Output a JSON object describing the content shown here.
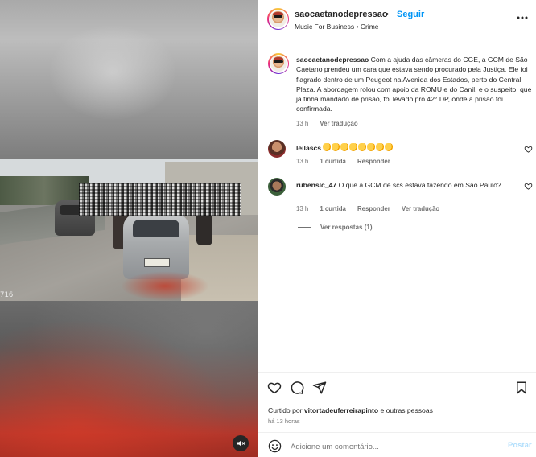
{
  "post": {
    "username": "saocaetanodepressao",
    "dot": "•",
    "follow_label": "Seguir",
    "subtitle": "Music For Business • Crime",
    "video_timestamp": "716"
  },
  "comments": [
    {
      "username": "saocaetanodepressao",
      "text": "Com a ajuda das câmeras do CGE, a GCM de São Caetano prendeu um cara que estava sendo procurado pela Justiça. Ele foi flagrado dentro de um Peugeot na Avenida dos Estados, perto do Central Plaza. A abordagem rolou com apoio da ROMU e do Canil, e o suspeito, que já tinha mandado de prisão, foi levado pro 42° DP, onde a prisão foi confirmada.",
      "time": "13 h",
      "translate": "Ver tradução"
    },
    {
      "username": "leilascs",
      "emoji_count": 8,
      "time": "13 h",
      "likes": "1 curtida",
      "reply": "Responder"
    },
    {
      "username": "rubenslc_47",
      "text": "O que a GCM de scs estava fazendo em São Paulo?",
      "time": "13 h",
      "likes": "1 curtida",
      "reply": "Responder",
      "translate": "Ver tradução",
      "view_replies": "Ver respostas (1)"
    }
  ],
  "footer": {
    "liked_prefix": "Curtido por",
    "liked_user": "vitortadeuferreirapinto",
    "liked_suffix": "e outras pessoas",
    "ago": "há 13 horas",
    "add_comment_placeholder": "Adicione um comentário...",
    "post_label": "Postar"
  },
  "icons": [
    "more-icon",
    "heart-icon",
    "comment-icon",
    "share-icon",
    "bookmark-icon",
    "emoji-icon",
    "mute-icon"
  ],
  "colors": {
    "accent": "#0095f6",
    "post_disabled": "#b2dffc",
    "muted_text": "#737373"
  }
}
